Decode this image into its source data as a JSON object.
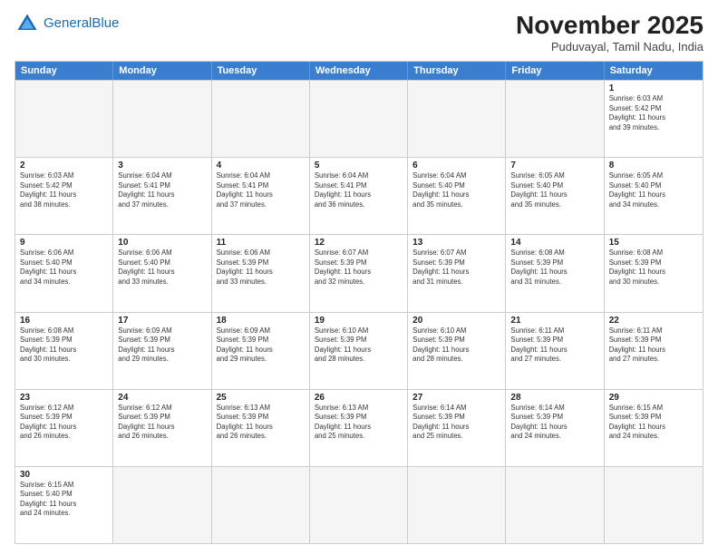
{
  "header": {
    "logo_general": "General",
    "logo_blue": "Blue",
    "title": "November 2025",
    "subtitle": "Puduvayal, Tamil Nadu, India"
  },
  "days": [
    "Sunday",
    "Monday",
    "Tuesday",
    "Wednesday",
    "Thursday",
    "Friday",
    "Saturday"
  ],
  "weeks": [
    [
      {
        "day": "",
        "info": ""
      },
      {
        "day": "",
        "info": ""
      },
      {
        "day": "",
        "info": ""
      },
      {
        "day": "",
        "info": ""
      },
      {
        "day": "",
        "info": ""
      },
      {
        "day": "",
        "info": ""
      },
      {
        "day": "1",
        "info": "Sunrise: 6:03 AM\nSunset: 5:42 PM\nDaylight: 11 hours\nand 39 minutes."
      }
    ],
    [
      {
        "day": "2",
        "info": "Sunrise: 6:03 AM\nSunset: 5:42 PM\nDaylight: 11 hours\nand 38 minutes."
      },
      {
        "day": "3",
        "info": "Sunrise: 6:04 AM\nSunset: 5:41 PM\nDaylight: 11 hours\nand 37 minutes."
      },
      {
        "day": "4",
        "info": "Sunrise: 6:04 AM\nSunset: 5:41 PM\nDaylight: 11 hours\nand 37 minutes."
      },
      {
        "day": "5",
        "info": "Sunrise: 6:04 AM\nSunset: 5:41 PM\nDaylight: 11 hours\nand 36 minutes."
      },
      {
        "day": "6",
        "info": "Sunrise: 6:04 AM\nSunset: 5:40 PM\nDaylight: 11 hours\nand 35 minutes."
      },
      {
        "day": "7",
        "info": "Sunrise: 6:05 AM\nSunset: 5:40 PM\nDaylight: 11 hours\nand 35 minutes."
      },
      {
        "day": "8",
        "info": "Sunrise: 6:05 AM\nSunset: 5:40 PM\nDaylight: 11 hours\nand 34 minutes."
      }
    ],
    [
      {
        "day": "9",
        "info": "Sunrise: 6:06 AM\nSunset: 5:40 PM\nDaylight: 11 hours\nand 34 minutes."
      },
      {
        "day": "10",
        "info": "Sunrise: 6:06 AM\nSunset: 5:40 PM\nDaylight: 11 hours\nand 33 minutes."
      },
      {
        "day": "11",
        "info": "Sunrise: 6:06 AM\nSunset: 5:39 PM\nDaylight: 11 hours\nand 33 minutes."
      },
      {
        "day": "12",
        "info": "Sunrise: 6:07 AM\nSunset: 5:39 PM\nDaylight: 11 hours\nand 32 minutes."
      },
      {
        "day": "13",
        "info": "Sunrise: 6:07 AM\nSunset: 5:39 PM\nDaylight: 11 hours\nand 31 minutes."
      },
      {
        "day": "14",
        "info": "Sunrise: 6:08 AM\nSunset: 5:39 PM\nDaylight: 11 hours\nand 31 minutes."
      },
      {
        "day": "15",
        "info": "Sunrise: 6:08 AM\nSunset: 5:39 PM\nDaylight: 11 hours\nand 30 minutes."
      }
    ],
    [
      {
        "day": "16",
        "info": "Sunrise: 6:08 AM\nSunset: 5:39 PM\nDaylight: 11 hours\nand 30 minutes."
      },
      {
        "day": "17",
        "info": "Sunrise: 6:09 AM\nSunset: 5:39 PM\nDaylight: 11 hours\nand 29 minutes."
      },
      {
        "day": "18",
        "info": "Sunrise: 6:09 AM\nSunset: 5:39 PM\nDaylight: 11 hours\nand 29 minutes."
      },
      {
        "day": "19",
        "info": "Sunrise: 6:10 AM\nSunset: 5:39 PM\nDaylight: 11 hours\nand 28 minutes."
      },
      {
        "day": "20",
        "info": "Sunrise: 6:10 AM\nSunset: 5:39 PM\nDaylight: 11 hours\nand 28 minutes."
      },
      {
        "day": "21",
        "info": "Sunrise: 6:11 AM\nSunset: 5:39 PM\nDaylight: 11 hours\nand 27 minutes."
      },
      {
        "day": "22",
        "info": "Sunrise: 6:11 AM\nSunset: 5:39 PM\nDaylight: 11 hours\nand 27 minutes."
      }
    ],
    [
      {
        "day": "23",
        "info": "Sunrise: 6:12 AM\nSunset: 5:39 PM\nDaylight: 11 hours\nand 26 minutes."
      },
      {
        "day": "24",
        "info": "Sunrise: 6:12 AM\nSunset: 5:39 PM\nDaylight: 11 hours\nand 26 minutes."
      },
      {
        "day": "25",
        "info": "Sunrise: 6:13 AM\nSunset: 5:39 PM\nDaylight: 11 hours\nand 26 minutes."
      },
      {
        "day": "26",
        "info": "Sunrise: 6:13 AM\nSunset: 5:39 PM\nDaylight: 11 hours\nand 25 minutes."
      },
      {
        "day": "27",
        "info": "Sunrise: 6:14 AM\nSunset: 5:39 PM\nDaylight: 11 hours\nand 25 minutes."
      },
      {
        "day": "28",
        "info": "Sunrise: 6:14 AM\nSunset: 5:39 PM\nDaylight: 11 hours\nand 24 minutes."
      },
      {
        "day": "29",
        "info": "Sunrise: 6:15 AM\nSunset: 5:39 PM\nDaylight: 11 hours\nand 24 minutes."
      }
    ],
    [
      {
        "day": "30",
        "info": "Sunrise: 6:15 AM\nSunset: 5:40 PM\nDaylight: 11 hours\nand 24 minutes."
      },
      {
        "day": "",
        "info": ""
      },
      {
        "day": "",
        "info": ""
      },
      {
        "day": "",
        "info": ""
      },
      {
        "day": "",
        "info": ""
      },
      {
        "day": "",
        "info": ""
      },
      {
        "day": "",
        "info": ""
      }
    ]
  ]
}
